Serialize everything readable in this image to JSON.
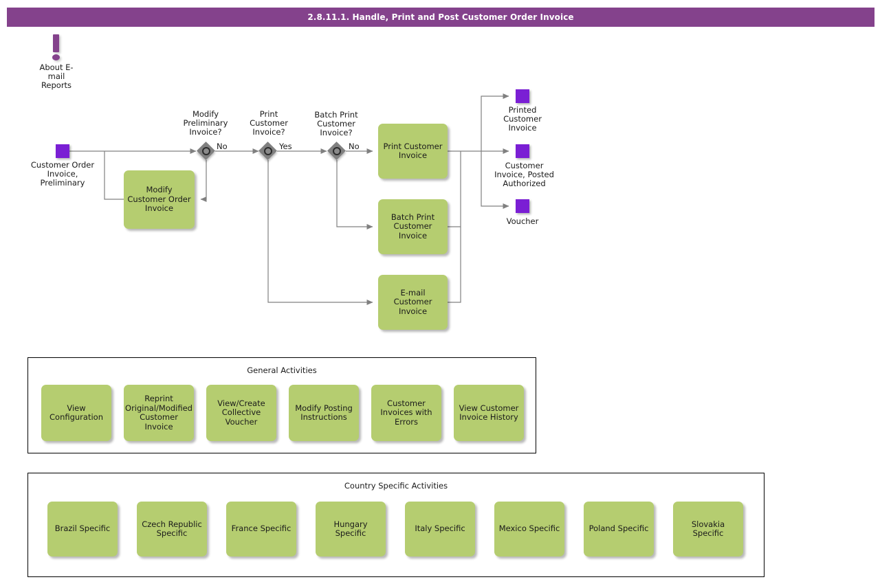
{
  "header": {
    "title": "2.8.11.1. Handle, Print and Post Customer Order Invoice",
    "bar_color": "#84428c"
  },
  "colors": {
    "accent_purple": "#84428c",
    "event_purple": "#7a1fd4",
    "task_green": "#b5cd70",
    "gateway_gray": "#808080",
    "connector_gray": "#808080"
  },
  "annotation": {
    "icon": "exclamation-icon",
    "label": "About E-\nmail\nReports"
  },
  "flow": {
    "start_event": {
      "icon": "message-event-icon",
      "label": "Customer Order\nInvoice,\nPreliminary"
    },
    "gateways": [
      {
        "id": "modify-preliminary-invoice",
        "title": "Modify\nPreliminary\nInvoice?",
        "branch_label": "No"
      },
      {
        "id": "print-customer-invoice",
        "title": "Print\nCustomer\nInvoice?",
        "branch_label": "Yes"
      },
      {
        "id": "batch-print-customer-invoice",
        "title": "Batch Print\nCustomer\nInvoice?",
        "branch_label": "No"
      }
    ],
    "tasks": [
      {
        "id": "modify-customer-order-invoice",
        "label": "Modify\nCustomer Order\nInvoice"
      },
      {
        "id": "print-customer-invoice",
        "label": "Print Customer\nInvoice"
      },
      {
        "id": "batch-print-customer-invoice",
        "label": "Batch Print\nCustomer\nInvoice"
      },
      {
        "id": "email-customer-invoice",
        "label": "E-mail Customer\nInvoice"
      }
    ],
    "end_events": [
      {
        "id": "printed-customer-invoice",
        "label": "Printed\nCustomer\nInvoice"
      },
      {
        "id": "customer-invoice-posted-authorized",
        "label": "Customer\nInvoice, Posted\nAuthorized"
      },
      {
        "id": "voucher",
        "label": "Voucher"
      }
    ]
  },
  "general_activities": {
    "title": "General Activities",
    "items": [
      {
        "label": "View\nConfiguration"
      },
      {
        "label": "Reprint\nOriginal/Modified\nCustomer\nInvoice"
      },
      {
        "label": "View/Create\nCollective\nVoucher"
      },
      {
        "label": "Modify Posting\nInstructions"
      },
      {
        "label": "Customer\nInvoices with\nErrors"
      },
      {
        "label": "View Customer\nInvoice History"
      }
    ]
  },
  "country_specific_activities": {
    "title": "Country Specific Activities",
    "items": [
      {
        "label": "Brazil Specific"
      },
      {
        "label": "Czech Republic\nSpecific"
      },
      {
        "label": "France Specific"
      },
      {
        "label": "Hungary Specific"
      },
      {
        "label": "Italy Specific"
      },
      {
        "label": "Mexico Specific"
      },
      {
        "label": "Poland Specific"
      },
      {
        "label": "Slovakia\nSpecific"
      }
    ]
  }
}
